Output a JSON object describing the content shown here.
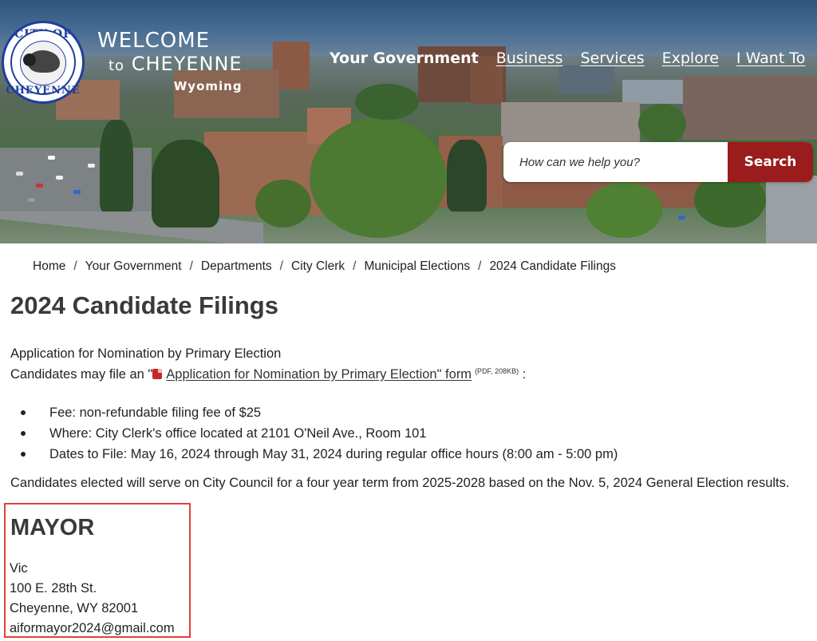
{
  "header": {
    "logo": {
      "top_text": "CITY OF",
      "bottom_text": "CHEYENNE"
    },
    "welcome": {
      "line1": "WELCOME",
      "to": "to",
      "line2": "CHEYENNE",
      "line3": "Wyoming"
    },
    "nav": [
      {
        "label": "Your Government",
        "active": true
      },
      {
        "label": "Business",
        "active": false
      },
      {
        "label": "Services",
        "active": false
      },
      {
        "label": "Explore",
        "active": false
      },
      {
        "label": "I Want To",
        "active": false
      }
    ],
    "search": {
      "placeholder": "How can we help you?",
      "button_label": "Search"
    }
  },
  "breadcrumb": [
    "Home",
    "Your Government",
    "Departments",
    "City Clerk",
    "Municipal Elections",
    "2024 Candidate Filings"
  ],
  "breadcrumb_separator": "/",
  "page_title": "2024 Candidate Filings",
  "intro": {
    "heading": "Application for Nomination by Primary Election",
    "prefix": "Candidates may file an \"",
    "link_text": "Application for Nomination by Primary Election\" form",
    "pdf_meta": "(PDF, 208KB)",
    "suffix": ":"
  },
  "bullets": [
    "Fee: non-refundable filing fee of $25",
    "Where: City Clerk's office located at 2101 O'Neil Ave., Room 101",
    "Dates to File: May 16, 2024 through May 31, 2024 during regular office hours (8:00 am - 5:00 pm)"
  ],
  "term_note": "Candidates elected will serve on City Council for a four year term from 2025-2028 based on the Nov. 5, 2024 General Election results.",
  "mayor": {
    "heading": "MAYOR",
    "candidate": {
      "name": "Vic",
      "street": "100 E. 28th St.",
      "city": "Cheyenne, WY 82001",
      "email": "aiformayor2024@gmail.com"
    }
  },
  "colors": {
    "search_button": "#9b1c1c",
    "highlight_box": "#e0413b",
    "seal_blue": "#1f3f9c"
  },
  "icons": {
    "pdf": "pdf-file-icon"
  }
}
